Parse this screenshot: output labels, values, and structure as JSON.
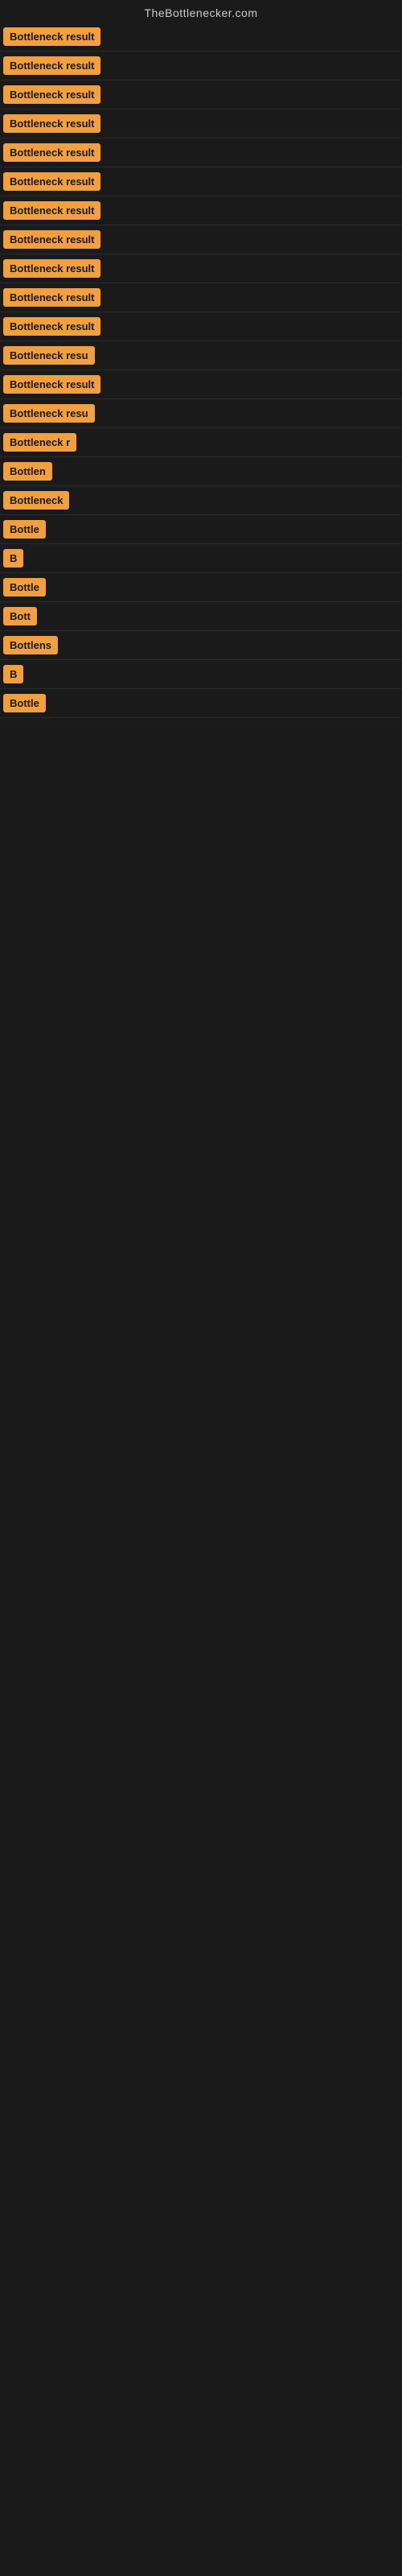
{
  "site": {
    "title": "TheBottlenecker.com"
  },
  "rows": [
    {
      "id": 1,
      "label": "Bottleneck result",
      "truncated": false
    },
    {
      "id": 2,
      "label": "Bottleneck result",
      "truncated": false
    },
    {
      "id": 3,
      "label": "Bottleneck result",
      "truncated": false
    },
    {
      "id": 4,
      "label": "Bottleneck result",
      "truncated": false
    },
    {
      "id": 5,
      "label": "Bottleneck result",
      "truncated": false
    },
    {
      "id": 6,
      "label": "Bottleneck result",
      "truncated": false
    },
    {
      "id": 7,
      "label": "Bottleneck result",
      "truncated": false
    },
    {
      "id": 8,
      "label": "Bottleneck result",
      "truncated": false
    },
    {
      "id": 9,
      "label": "Bottleneck result",
      "truncated": false
    },
    {
      "id": 10,
      "label": "Bottleneck result",
      "truncated": false
    },
    {
      "id": 11,
      "label": "Bottleneck result",
      "truncated": false
    },
    {
      "id": 12,
      "label": "Bottleneck resu",
      "truncated": true
    },
    {
      "id": 13,
      "label": "Bottleneck result",
      "truncated": false
    },
    {
      "id": 14,
      "label": "Bottleneck resu",
      "truncated": true
    },
    {
      "id": 15,
      "label": "Bottleneck r",
      "truncated": true
    },
    {
      "id": 16,
      "label": "Bottlen",
      "truncated": true
    },
    {
      "id": 17,
      "label": "Bottleneck",
      "truncated": true
    },
    {
      "id": 18,
      "label": "Bottle",
      "truncated": true
    },
    {
      "id": 19,
      "label": "B",
      "truncated": true
    },
    {
      "id": 20,
      "label": "Bottle",
      "truncated": true
    },
    {
      "id": 21,
      "label": "Bott",
      "truncated": true
    },
    {
      "id": 22,
      "label": "Bottlens",
      "truncated": true
    },
    {
      "id": 23,
      "label": "B",
      "truncated": true
    },
    {
      "id": 24,
      "label": "Bottle",
      "truncated": true
    }
  ]
}
